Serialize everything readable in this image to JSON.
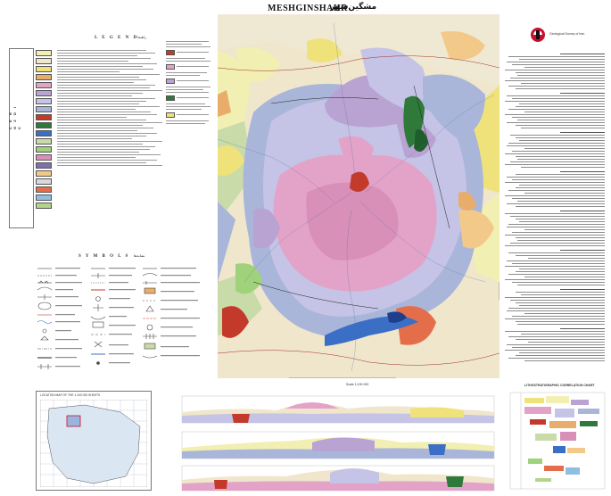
{
  "sheet": {
    "title_en": "MESHGINSHAHR",
    "title_fa": "مشگین‌شهر",
    "legend_heading": "L E G E N D",
    "legend_heading_fa": "راهنما",
    "symbols_heading": "S Y M B O L S",
    "symbols_heading_fa": "نشانه‌ها",
    "era_label": "C E N O Z O I C",
    "scale_label": "Scale 1:100 000",
    "stratigraphic_chart_title": "LITHOSTRATIGRAPHIC CORRELATION CHART",
    "location_map_title": "LOCATION MAP OF THE 1:100 000 SHEETS"
  },
  "colors": {
    "pink": "#e3a3c8",
    "purple": "#b9a3d3",
    "lavender": "#c5c3e6",
    "blue_grey": "#a9b6d9",
    "pale_yellow": "#f2efb2",
    "yellow": "#f0e27a",
    "beige": "#efe6cc",
    "orange": "#e8ad6a",
    "red": "#c43a2a",
    "dark_green": "#2f7a3a",
    "blue": "#3b6fc6",
    "light_green": "#c9dba8",
    "grey": "#c9c9c9"
  },
  "legend_swatches": [
    "#f2efb2",
    "#efe6cc",
    "#f0e27a",
    "#e8ad6a",
    "#e3a3c8",
    "#b9a3d3",
    "#c5c3e6",
    "#a9b6d9",
    "#c43a2a",
    "#2f7a3a",
    "#3b6fc6",
    "#c9dba8",
    "#9fd27a",
    "#d88fb8",
    "#7f6fb0",
    "#f3c98a",
    "#d9d9d9",
    "#e56e4a",
    "#8fbfe0",
    "#b5d38a"
  ],
  "symbols": [
    "contact-line",
    "fault",
    "thrust",
    "anticline",
    "syncline",
    "strike-dip",
    "road",
    "river",
    "village",
    "spot-height",
    "mine",
    "spring"
  ],
  "publisher_logo": "Geological Survey of Iran"
}
